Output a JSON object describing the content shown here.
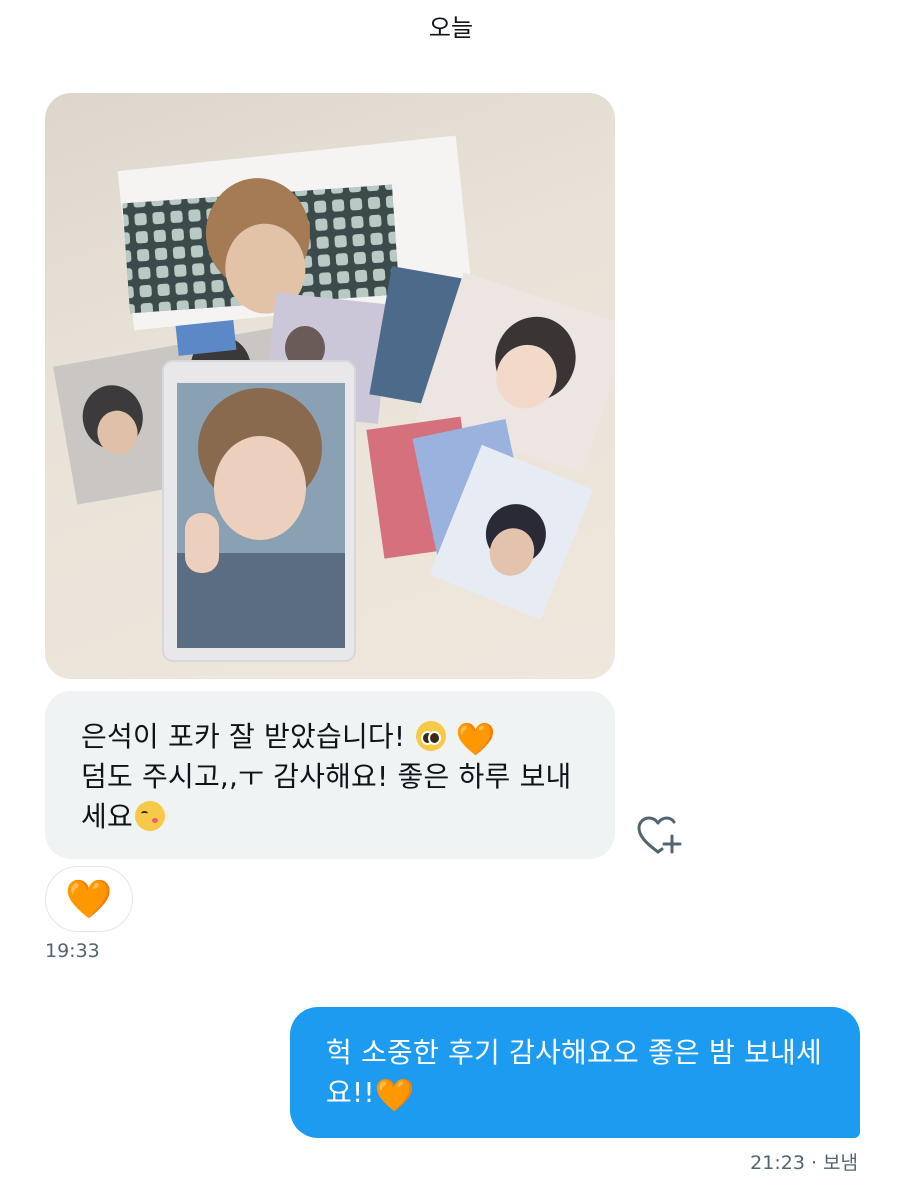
{
  "header": {
    "date_label": "오늘"
  },
  "received_message": {
    "line1": "은석이 포카 잘 받았습니다! ",
    "line2": "덤도 주시고,,ㅜ 감사해요! 좋은 하루 보내",
    "line3": "세요",
    "heart_emoji": "🧡",
    "reaction": "🧡",
    "time": "19:33"
  },
  "sent_message": {
    "line1": "헉 소중한 후기 감사해요오 좋은 밤 보내세",
    "line2": "요!!",
    "heart_emoji": "🧡",
    "time": "21:23 · 보냄"
  },
  "colors": {
    "sent_bubble": "#1d9bf0",
    "received_bubble": "#eff3f4",
    "heart": "#f5881f",
    "timestamp": "#536471"
  },
  "icons": {
    "react": "heart-plus-icon",
    "emoji_1": "pleading-face-icon",
    "emoji_2": "kissing-face-icon"
  }
}
